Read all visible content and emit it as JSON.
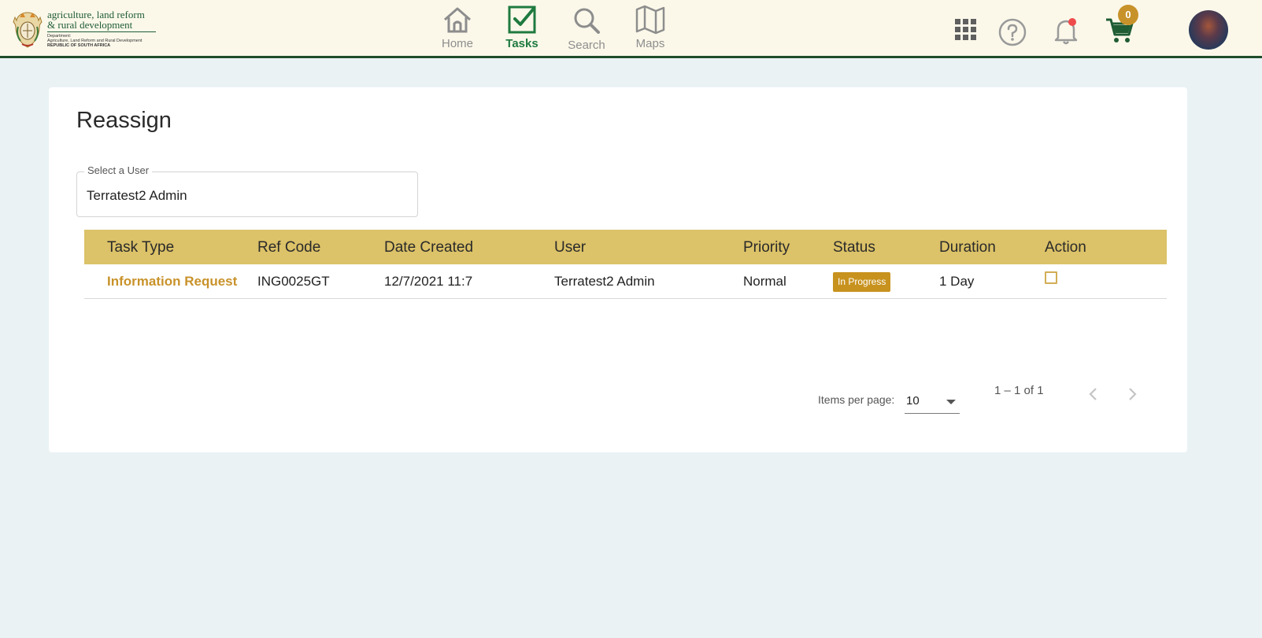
{
  "header": {
    "logo": {
      "line1": "agriculture, land reform",
      "line2": "& rural development",
      "small1": "Department:",
      "small2": "Agriculture, Land Reform and Rural Development",
      "small3": "REPUBLIC OF SOUTH AFRICA"
    },
    "nav": [
      {
        "label": "Home",
        "icon": "home-icon"
      },
      {
        "label": "Tasks",
        "icon": "tasks-check-icon",
        "active": true
      },
      {
        "label": "Search",
        "icon": "search-icon"
      },
      {
        "label": "Maps",
        "icon": "map-icon"
      }
    ],
    "icons": [
      "apps-grid-icon",
      "help-icon",
      "notification-bell-icon",
      "cart-icon"
    ],
    "cart_count": "0"
  },
  "main": {
    "title": "Reassign",
    "user_select": {
      "label": "Select a User",
      "value": "Terratest2 Admin"
    },
    "table": {
      "columns": [
        "Task Type",
        "Ref Code",
        "Date Created",
        "User",
        "Priority",
        "Status",
        "Duration",
        "Action"
      ],
      "rows": [
        {
          "task_type": "Information Request",
          "ref_code": "ING0025GT",
          "date_created": "12/7/2021 11:7",
          "user": "Terratest2 Admin",
          "priority": "Normal",
          "status": "In Progress",
          "duration": "1 Day",
          "action_checked": false
        }
      ]
    },
    "paginator": {
      "items_per_page_label": "Items per page:",
      "items_per_page": "10",
      "range": "1 – 1 of 1"
    }
  },
  "colors": {
    "header_bg": "#fbf8ea",
    "header_border": "#1f4d2b",
    "accent": "#c8922a",
    "table_header": "#dcc268",
    "nav_active": "#1f7a3f",
    "page_bg": "#eaf2f4"
  }
}
